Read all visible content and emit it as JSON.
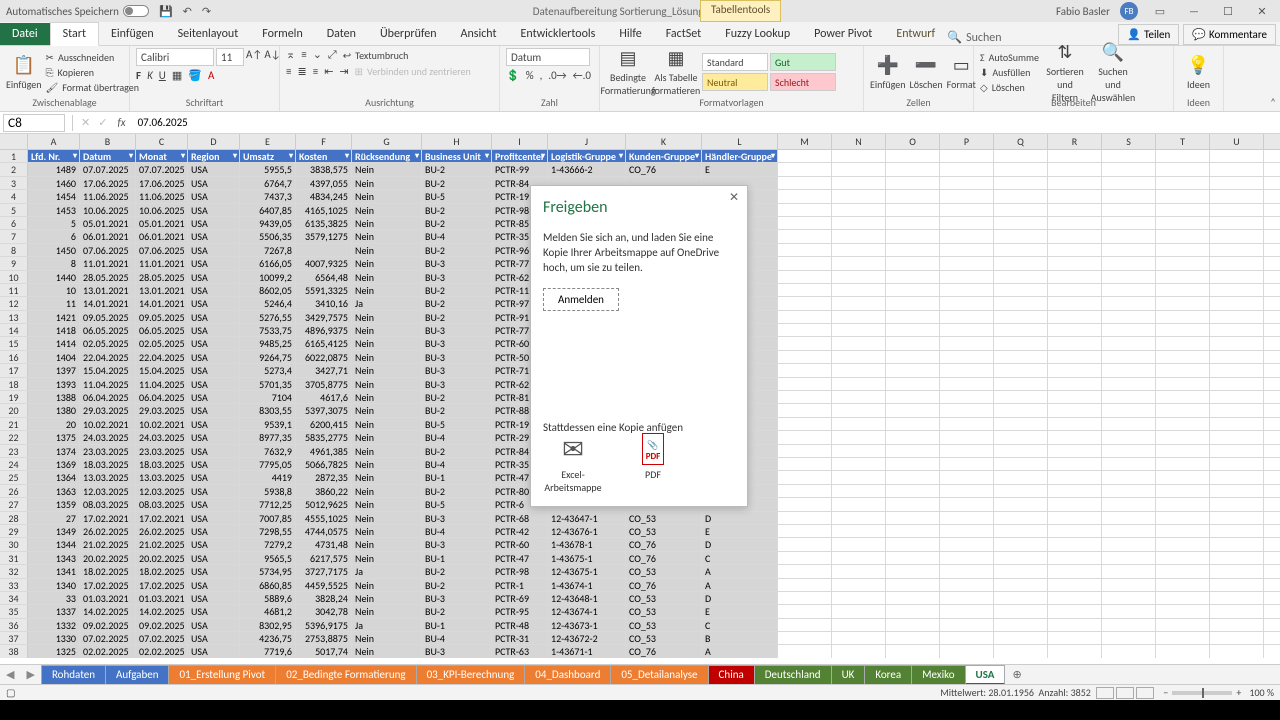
{
  "title": {
    "autosave": "Automatisches Speichern",
    "doc": "Datenaufbereitung Sortierung_Lösung - Excel",
    "context": "Tabellentools",
    "user": "Fabio Basler",
    "initials": "FB"
  },
  "tabs": {
    "file": "Datei",
    "home": "Start",
    "insert": "Einfügen",
    "layout": "Seitenlayout",
    "formulas": "Formeln",
    "data": "Daten",
    "review": "Überprüfen",
    "view": "Ansicht",
    "dev": "Entwicklertools",
    "help": "Hilfe",
    "factset": "FactSet",
    "fuzzy": "Fuzzy Lookup",
    "pp": "Power Pivot",
    "design": "Entwurf",
    "search": "Suchen",
    "share": "Teilen",
    "comments": "Kommentare"
  },
  "ribbon": {
    "clipboard": {
      "label": "Zwischenablage",
      "paste": "Einfügen",
      "cut": "Ausschneiden",
      "copy": "Kopieren",
      "format": "Format übertragen"
    },
    "font": {
      "label": "Schriftart",
      "name": "Calibri",
      "size": "11"
    },
    "align": {
      "label": "Ausrichtung",
      "wrap": "Textumbruch",
      "merge": "Verbinden und zentrieren"
    },
    "number": {
      "label": "Zahl",
      "format": "Datum"
    },
    "styles": {
      "label": "Formatvorlagen",
      "cond": "Bedingte Formatierung",
      "table": "Als Tabelle formatieren",
      "std": "Standard",
      "gut": "Gut",
      "neu": "Neutral",
      "sch": "Schlecht"
    },
    "cells": {
      "label": "Zellen",
      "ins": "Einfügen",
      "del": "Löschen",
      "fmt": "Format"
    },
    "edit": {
      "label": "Bearbeiten",
      "sum": "AutoSumme",
      "fill": "Ausfüllen",
      "clear": "Löschen",
      "sort": "Sortieren und Filtern",
      "find": "Suchen und Auswählen"
    },
    "ideas": {
      "label": "Ideen",
      "btn": "Ideen"
    }
  },
  "fbar": {
    "ref": "C8",
    "val": "07.06.2025"
  },
  "cols": [
    "A",
    "B",
    "C",
    "D",
    "E",
    "F",
    "G",
    "H",
    "I",
    "J",
    "K",
    "L",
    "M",
    "N",
    "O",
    "P",
    "Q",
    "R",
    "S",
    "T",
    "U"
  ],
  "headers": [
    "Lfd. Nr.",
    "Datum",
    "Monat",
    "Region",
    "Umsatz",
    "Kosten",
    "Rücksendung",
    "Business Unit",
    "Profitcenter",
    "Logistik-Gruppe",
    "Kunden-Gruppe",
    "Händler-Gruppe"
  ],
  "rows": [
    {
      "n": 2,
      "c": [
        "1489",
        "07.07.2025",
        "07.07.2025",
        "USA",
        "5955,5",
        "3838,575",
        "Nein",
        "BU-2",
        "PCTR-99",
        "1-43666-2",
        "CO_76",
        "E"
      ]
    },
    {
      "n": 3,
      "c": [
        "1460",
        "17.06.2025",
        "17.06.2025",
        "USA",
        "6764,7",
        "4397,055",
        "Nein",
        "BU-2",
        "PCTR-84",
        "",
        "",
        ""
      ]
    },
    {
      "n": 4,
      "c": [
        "1454",
        "11.06.2025",
        "11.06.2025",
        "USA",
        "7437,3",
        "4834,245",
        "Nein",
        "BU-5",
        "PCTR-19",
        "",
        "",
        ""
      ]
    },
    {
      "n": 5,
      "c": [
        "1453",
        "10.06.2025",
        "10.06.2025",
        "USA",
        "6407,85",
        "4165,1025",
        "Nein",
        "BU-2",
        "PCTR-98",
        "",
        "",
        ""
      ]
    },
    {
      "n": 6,
      "c": [
        "5",
        "05.01.2021",
        "05.01.2021",
        "USA",
        "9439,05",
        "6135,3825",
        "Nein",
        "BU-2",
        "PCTR-85",
        "",
        "",
        ""
      ]
    },
    {
      "n": 7,
      "c": [
        "6",
        "06.01.2021",
        "06.01.2021",
        "USA",
        "5506,35",
        "3579,1275",
        "Nein",
        "BU-4",
        "PCTR-35",
        "",
        "",
        ""
      ]
    },
    {
      "n": 8,
      "c": [
        "1450",
        "07.06.2025",
        "07.06.2025",
        "USA",
        "7267,8",
        "",
        "Nein",
        "BU-2",
        "PCTR-96",
        "",
        "",
        ""
      ]
    },
    {
      "n": 9,
      "c": [
        "8",
        "11.01.2021",
        "11.01.2021",
        "USA",
        "6166,05",
        "4007,9325",
        "Nein",
        "BU-3",
        "PCTR-77",
        "",
        "",
        ""
      ]
    },
    {
      "n": 10,
      "c": [
        "1440",
        "28.05.2025",
        "28.05.2025",
        "USA",
        "10099,2",
        "6564,48",
        "Nein",
        "BU-3",
        "PCTR-62",
        "",
        "",
        ""
      ]
    },
    {
      "n": 11,
      "c": [
        "10",
        "13.01.2021",
        "13.01.2021",
        "USA",
        "8602,05",
        "5591,3325",
        "Nein",
        "BU-2",
        "PCTR-11",
        "",
        "",
        ""
      ]
    },
    {
      "n": 12,
      "c": [
        "11",
        "14.01.2021",
        "14.01.2021",
        "USA",
        "5246,4",
        "3410,16",
        "Ja",
        "BU-2",
        "PCTR-97",
        "",
        "",
        ""
      ]
    },
    {
      "n": 13,
      "c": [
        "1421",
        "09.05.2025",
        "09.05.2025",
        "USA",
        "5276,55",
        "3429,7575",
        "Nein",
        "BU-2",
        "PCTR-91",
        "",
        "",
        ""
      ]
    },
    {
      "n": 14,
      "c": [
        "1418",
        "06.05.2025",
        "06.05.2025",
        "USA",
        "7533,75",
        "4896,9375",
        "Nein",
        "BU-3",
        "PCTR-77",
        "",
        "",
        ""
      ]
    },
    {
      "n": 15,
      "c": [
        "1414",
        "02.05.2025",
        "02.05.2025",
        "USA",
        "9485,25",
        "6165,4125",
        "Nein",
        "BU-3",
        "PCTR-60",
        "",
        "",
        ""
      ]
    },
    {
      "n": 16,
      "c": [
        "1404",
        "22.04.2025",
        "22.04.2025",
        "USA",
        "9264,75",
        "6022,0875",
        "Nein",
        "BU-3",
        "PCTR-50",
        "",
        "",
        ""
      ]
    },
    {
      "n": 17,
      "c": [
        "1397",
        "15.04.2025",
        "15.04.2025",
        "USA",
        "5273,4",
        "3427,71",
        "Nein",
        "BU-3",
        "PCTR-71",
        "",
        "",
        ""
      ]
    },
    {
      "n": 18,
      "c": [
        "1393",
        "11.04.2025",
        "11.04.2025",
        "USA",
        "5701,35",
        "3705,8775",
        "Nein",
        "BU-3",
        "PCTR-62",
        "",
        "",
        ""
      ]
    },
    {
      "n": 19,
      "c": [
        "1388",
        "06.04.2025",
        "06.04.2025",
        "USA",
        "7104",
        "4617,6",
        "Nein",
        "BU-2",
        "PCTR-81",
        "",
        "",
        ""
      ]
    },
    {
      "n": 20,
      "c": [
        "1380",
        "29.03.2025",
        "29.03.2025",
        "USA",
        "8303,55",
        "5397,3075",
        "Nein",
        "BU-2",
        "PCTR-88",
        "",
        "",
        ""
      ]
    },
    {
      "n": 21,
      "c": [
        "20",
        "10.02.2021",
        "10.02.2021",
        "USA",
        "9539,1",
        "6200,415",
        "Nein",
        "BU-5",
        "PCTR-19",
        "",
        "",
        ""
      ]
    },
    {
      "n": 22,
      "c": [
        "1375",
        "24.03.2025",
        "24.03.2025",
        "USA",
        "8977,35",
        "5835,2775",
        "Nein",
        "BU-4",
        "PCTR-29",
        "",
        "",
        ""
      ]
    },
    {
      "n": 23,
      "c": [
        "1374",
        "23.03.2025",
        "23.03.2025",
        "USA",
        "7632,9",
        "4961,385",
        "Nein",
        "BU-2",
        "PCTR-84",
        "",
        "",
        ""
      ]
    },
    {
      "n": 24,
      "c": [
        "1369",
        "18.03.2025",
        "18.03.2025",
        "USA",
        "7795,05",
        "5066,7825",
        "Nein",
        "BU-4",
        "PCTR-35",
        "",
        "",
        ""
      ]
    },
    {
      "n": 25,
      "c": [
        "1364",
        "13.03.2025",
        "13.03.2025",
        "USA",
        "4419",
        "2872,35",
        "Nein",
        "BU-1",
        "PCTR-47",
        "",
        "",
        ""
      ]
    },
    {
      "n": 26,
      "c": [
        "1363",
        "12.03.2025",
        "12.03.2025",
        "USA",
        "5938,8",
        "3860,22",
        "Nein",
        "BU-2",
        "PCTR-80",
        "",
        "",
        ""
      ]
    },
    {
      "n": 27,
      "c": [
        "1359",
        "08.03.2025",
        "08.03.2025",
        "USA",
        "7712,25",
        "5012,9625",
        "Nein",
        "BU-5",
        "PCTR-6",
        "",
        "",
        ""
      ]
    },
    {
      "n": 28,
      "c": [
        "27",
        "17.02.2021",
        "17.02.2021",
        "USA",
        "7007,85",
        "4555,1025",
        "Nein",
        "BU-3",
        "PCTR-68",
        "12-43647-1",
        "CO_53",
        "D"
      ]
    },
    {
      "n": 29,
      "c": [
        "1349",
        "26.02.2025",
        "26.02.2025",
        "USA",
        "7298,55",
        "4744,0575",
        "Nein",
        "BU-4",
        "PCTR-42",
        "12-43676-1",
        "CO_53",
        "E"
      ]
    },
    {
      "n": 30,
      "c": [
        "1344",
        "21.02.2025",
        "21.02.2025",
        "USA",
        "7279,2",
        "4731,48",
        "Nein",
        "BU-3",
        "PCTR-60",
        "1-43678-1",
        "CO_76",
        "D"
      ]
    },
    {
      "n": 31,
      "c": [
        "1343",
        "20.02.2025",
        "20.02.2025",
        "USA",
        "9565,5",
        "6217,575",
        "Nein",
        "BU-1",
        "PCTR-47",
        "1-43675-1",
        "CO_76",
        "C"
      ]
    },
    {
      "n": 32,
      "c": [
        "1341",
        "18.02.2025",
        "18.02.2025",
        "USA",
        "5734,95",
        "3727,7175",
        "Ja",
        "BU-2",
        "PCTR-98",
        "12-43675-1",
        "CO_53",
        "A"
      ]
    },
    {
      "n": 33,
      "c": [
        "1340",
        "17.02.2025",
        "17.02.2025",
        "USA",
        "6860,85",
        "4459,5525",
        "Nein",
        "BU-2",
        "PCTR-1",
        "1-43674-1",
        "CO_76",
        "A"
      ]
    },
    {
      "n": 34,
      "c": [
        "33",
        "01.03.2021",
        "01.03.2021",
        "USA",
        "5889,6",
        "3828,24",
        "Nein",
        "BU-3",
        "PCTR-69",
        "12-43648-1",
        "CO_53",
        "D"
      ]
    },
    {
      "n": 35,
      "c": [
        "1337",
        "14.02.2025",
        "14.02.2025",
        "USA",
        "4681,2",
        "3042,78",
        "Nein",
        "BU-2",
        "PCTR-95",
        "12-43674-1",
        "CO_53",
        "E"
      ]
    },
    {
      "n": 36,
      "c": [
        "1332",
        "09.02.2025",
        "09.02.2025",
        "USA",
        "8302,95",
        "5396,9175",
        "Ja",
        "BU-1",
        "PCTR-48",
        "12-43673-1",
        "CO_53",
        "C"
      ]
    },
    {
      "n": 37,
      "c": [
        "1330",
        "07.02.2025",
        "07.02.2025",
        "USA",
        "4236,75",
        "2753,8875",
        "Nein",
        "BU-4",
        "PCTR-31",
        "12-43672-2",
        "CO_53",
        "B"
      ]
    },
    {
      "n": 38,
      "c": [
        "1325",
        "02.02.2025",
        "02.02.2025",
        "USA",
        "7719,6",
        "5017,74",
        "Nein",
        "BU-3",
        "PCTR-63",
        "1-43671-1",
        "CO_76",
        "A"
      ]
    }
  ],
  "sheets": [
    {
      "name": "Rohdaten",
      "cls": "blue"
    },
    {
      "name": "Aufgaben",
      "cls": "blue"
    },
    {
      "name": "01_Erstellung Pivot",
      "cls": "orange"
    },
    {
      "name": "02_Bedingte Formatierung",
      "cls": "orange"
    },
    {
      "name": "03_KPI-Berechnung",
      "cls": "orange"
    },
    {
      "name": "04_Dashboard",
      "cls": "orange"
    },
    {
      "name": "05_Detailanalyse",
      "cls": "orange"
    },
    {
      "name": "China",
      "cls": "red"
    },
    {
      "name": "Deutschland",
      "cls": "green"
    },
    {
      "name": "UK",
      "cls": "green"
    },
    {
      "name": "Korea",
      "cls": "green"
    },
    {
      "name": "Mexiko",
      "cls": "green"
    },
    {
      "name": "USA",
      "cls": "active"
    }
  ],
  "status": {
    "avg": "Mittelwert: 28.01.1956",
    "count": "Anzahl: 3852",
    "zoom": "100 %"
  },
  "dialog": {
    "title": "Freigeben",
    "text": "Melden Sie sich an, und laden Sie eine Kopie Ihrer Arbeitsmappe auf OneDrive hoch, um sie zu teilen.",
    "login": "Anmelden",
    "attach": "Stattdessen eine Kopie anfügen",
    "excel": "Excel-Arbeitsmappe",
    "pdf": "PDF"
  }
}
